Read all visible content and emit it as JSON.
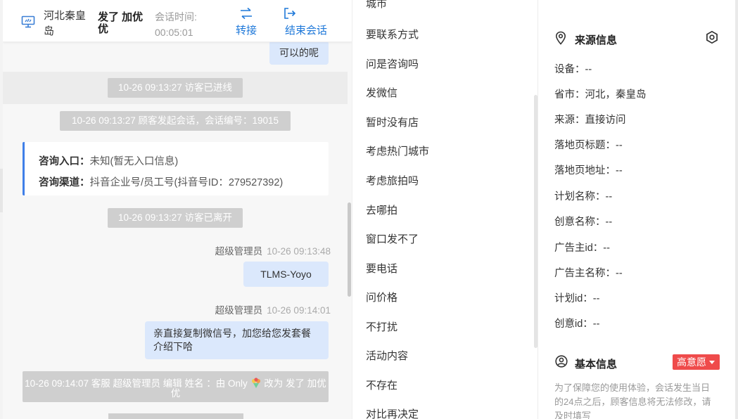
{
  "header": {
    "visitor_region": "河北秦皇岛",
    "visitor_name": "发了 加优优",
    "session_time_label": "会话时间:",
    "session_time_value": "00:05:01",
    "transfer_label": "转接",
    "end_session_label": "结束会话"
  },
  "messages": {
    "top_bubble": "可以的呢",
    "sys_entered": "10-26 09:13:27 访客已进线",
    "sys_started": "10-26 09:13:27 顾客发起会话，会话编号：19015",
    "info_card": {
      "entry_key": "咨询入口：",
      "entry_value": "未知(暂无入口信息)",
      "channel_key": "咨询渠道：",
      "channel_value": "抖音企业号/员工号(抖音号ID：279527392)"
    },
    "sys_left": "10-26 09:13:27 访客已离开",
    "msg1": {
      "sender": "超级管理员",
      "time": "10-26 09:13:48",
      "text": "TLMS-Yoyo"
    },
    "msg2": {
      "sender": "超级管理员",
      "time": "10-26 09:14:01",
      "text": "亲直接复制微信号，加您给您发套餐介绍下哈"
    },
    "rename_notice_a": "10-26 09:14:07 客服 超级管理员 编辑 姓名 ：由 Only",
    "rename_notice_b": "改为 发了 加优优"
  },
  "quick_replies": {
    "partial_top": "城市",
    "items": [
      "要联系方式",
      "问是咨询吗",
      "发微信",
      "暂时没有店",
      "考虑热门城市",
      "考虑旅拍吗",
      "去哪拍",
      "窗口发不了",
      "要电话",
      "问价格",
      "不打扰",
      "活动内容",
      "不存在",
      "对比再决定"
    ]
  },
  "source_info": {
    "title": "来源信息",
    "fields": [
      "设备：--",
      "省市：河北，秦皇岛",
      "来源：直接访问",
      "落地页标题：--",
      "落地页地址：--",
      "计划名称：--",
      "创意名称：--",
      "广告主id：--",
      "广告主名称：--",
      "计划id：--",
      "创意id：--"
    ]
  },
  "basic_info": {
    "title": "基本信息",
    "intent_badge": "高意愿",
    "notice": "为了保障您的使用体验，会话发生当日的24点之后，顾客信息将无法修改，请及时填写"
  },
  "colors": {
    "accent_blue": "#1e78d9",
    "bubble_blue": "#dbe8fc",
    "system_pill_gray": "#cfcfcf",
    "intent_red": "#ef4b4b",
    "info_card_border": "#3f7fe8"
  }
}
